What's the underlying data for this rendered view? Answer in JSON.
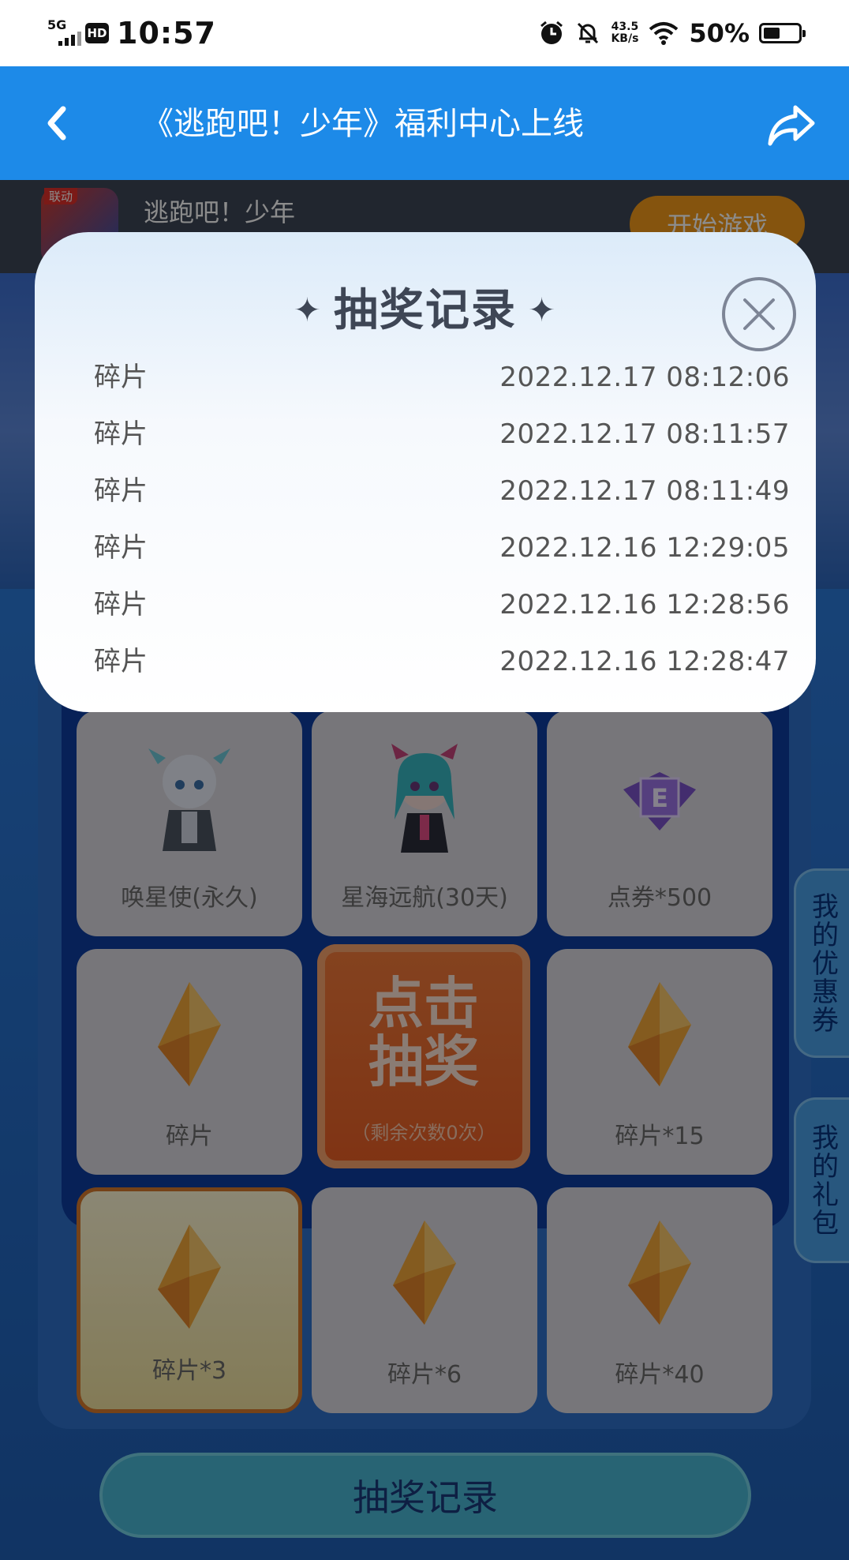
{
  "status_bar": {
    "signal_label": "5G",
    "hd_label": "HD",
    "time": "10:57",
    "net_speed_value": "43.5",
    "net_speed_unit": "KB/s",
    "battery_percent": "50%"
  },
  "header": {
    "title": "《逃跑吧！少年》福利中心上线"
  },
  "game_bar": {
    "icon_badge": "联动",
    "name": "逃跑吧！少年",
    "start_button": "开始游戏"
  },
  "modal": {
    "title": "抽奖记录",
    "records": [
      {
        "item": "碎片",
        "time": "2022.12.17 08:12:06"
      },
      {
        "item": "碎片",
        "time": "2022.12.17 08:11:57"
      },
      {
        "item": "碎片",
        "time": "2022.12.17 08:11:49"
      },
      {
        "item": "碎片",
        "time": "2022.12.16 12:29:05"
      },
      {
        "item": "碎片",
        "time": "2022.12.16 12:28:56"
      },
      {
        "item": "碎片",
        "time": "2022.12.16 12:28:47"
      }
    ]
  },
  "prize_grid": {
    "cells": [
      {
        "label": "唤星使(永久)",
        "icon": "character-icon"
      },
      {
        "label": "星海远航(30天)",
        "icon": "character-icon"
      },
      {
        "label": "点券*500",
        "icon": "ticket-icon"
      },
      {
        "label": "碎片",
        "icon": "gem-icon"
      },
      {
        "label": "碎片*15",
        "icon": "gem-icon"
      },
      {
        "label": "碎片*3",
        "icon": "gem-icon"
      },
      {
        "label": "碎片*6",
        "icon": "gem-icon"
      },
      {
        "label": "碎片*40",
        "icon": "gem-icon"
      }
    ],
    "draw_button": {
      "line1": "点击",
      "line2": "抽奖",
      "remaining": "（剩余次数0次）"
    }
  },
  "records_button": "抽奖记录",
  "side_tabs": {
    "coupons": "我的优惠券",
    "gifts": "我的礼包"
  },
  "colors": {
    "header_blue": "#1d8ae8",
    "draw_orange": "#e85e25",
    "modal_title": "#3e4655"
  }
}
